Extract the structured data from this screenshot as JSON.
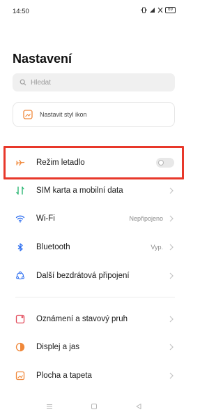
{
  "status_bar": {
    "time": "14:50",
    "battery": "69",
    "icons": [
      "vibrate-icon",
      "signal-icon",
      "no-sim-icon",
      "battery-icon"
    ]
  },
  "page": {
    "title": "Nastavení"
  },
  "search": {
    "placeholder": "Hledat"
  },
  "icon_style_card": {
    "label": "Nastavit styl ikon"
  },
  "rows": [
    {
      "label": "Režim letadlo",
      "value": "",
      "icon": "airplane-icon",
      "toggle": true,
      "toggle_on": false
    },
    {
      "label": "SIM karta a mobilní data",
      "value": "",
      "icon": "sim-data-icon"
    },
    {
      "label": "Wi-Fi",
      "value": "Nepřipojeno",
      "icon": "wifi-icon"
    },
    {
      "label": "Bluetooth",
      "value": "Vyp.",
      "icon": "bluetooth-icon"
    },
    {
      "label": "Další bezdrátová připojení",
      "value": "",
      "icon": "connections-icon"
    },
    {
      "label": "Oznámení a stavový pruh",
      "value": "",
      "icon": "notification-icon"
    },
    {
      "label": "Displej a jas",
      "value": "",
      "icon": "display-icon"
    },
    {
      "label": "Plocha a tapeta",
      "value": "",
      "icon": "wallpaper-icon"
    }
  ],
  "colors": {
    "accent": "#2a6cf0",
    "orange": "#f0883a",
    "green": "#2bb673",
    "red_highlight": "#e8382a"
  },
  "nav": {
    "icons": [
      "menu-icon",
      "home-icon",
      "back-icon"
    ]
  }
}
